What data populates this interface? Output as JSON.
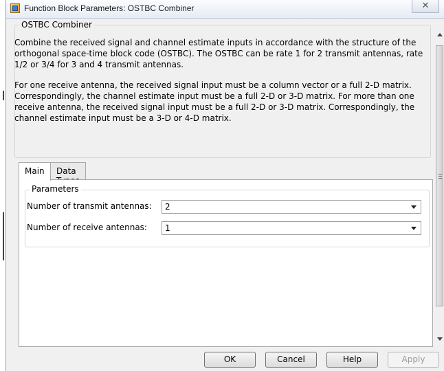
{
  "window": {
    "title": "Function Block Parameters: OSTBC Combiner",
    "close_glyph": "✕"
  },
  "block": {
    "name": "OSTBC Combiner",
    "description": [
      "Combine the received signal and channel estimate inputs in accordance with the structure of the orthogonal space-time block code (OSTBC). The OSTBC can be rate 1 for 2 transmit antennas, rate 1/2 or 3/4 for 3 and 4 transmit antennas.",
      "For one receive antenna, the received signal input must be a column vector or a full 2-D matrix. Correspondingly, the channel estimate input must be a full 2-D or 3-D matrix. For more than one receive antenna, the received signal input must be a full 2-D or 3-D matrix. Correspondingly, the channel estimate input must be a 3-D or 4-D matrix."
    ]
  },
  "tabs": [
    {
      "label": "Main",
      "active": true
    },
    {
      "label": "Data Types",
      "active": false
    }
  ],
  "parameters": {
    "group_label": "Parameters",
    "fields": [
      {
        "label": "Number of transmit antennas:",
        "value": "2"
      },
      {
        "label": "Number of receive antennas:",
        "value": "1"
      }
    ]
  },
  "buttons": {
    "ok": "OK",
    "cancel": "Cancel",
    "help": "Help",
    "apply": "Apply"
  },
  "icons": {
    "app": "simulink-block-icon",
    "close": "close-icon",
    "dropdown": "chevron-down-icon"
  }
}
